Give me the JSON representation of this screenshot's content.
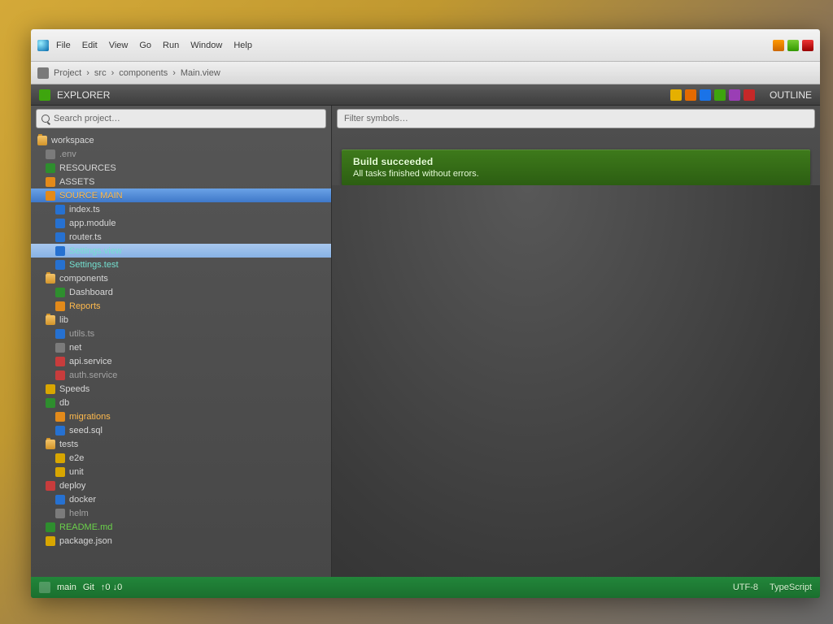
{
  "menubar": {
    "items": [
      "File",
      "Edit",
      "View",
      "Go",
      "Run",
      "Window",
      "Help"
    ]
  },
  "pathbar": {
    "root": "Project",
    "crumb1": "src",
    "crumb2": "components",
    "crumb3": "Main.view"
  },
  "secheader": {
    "label": "EXPLORER",
    "rightLabel": "OUTLINE"
  },
  "project_search_placeholder": "Search project…",
  "content_search_placeholder": "Filter symbols…",
  "tree": {
    "nodes": [
      {
        "label": "workspace",
        "icon": "folder",
        "cls": "",
        "lvl": 0
      },
      {
        "label": ".env",
        "icon": "gray",
        "cls": "dim",
        "lvl": 1
      },
      {
        "label": "RESOURCES",
        "icon": "green",
        "cls": "",
        "lvl": 1
      },
      {
        "label": "ASSETS",
        "icon": "orange",
        "cls": "",
        "lvl": 1
      },
      {
        "label": "SOURCE MAIN",
        "icon": "orange",
        "cls": "warn sel",
        "lvl": 1
      },
      {
        "label": "index.ts",
        "icon": "blue",
        "cls": "",
        "lvl": 2
      },
      {
        "label": "app.module",
        "icon": "blue",
        "cls": "",
        "lvl": 2
      },
      {
        "label": "router.ts",
        "icon": "blue",
        "cls": "",
        "lvl": 2
      },
      {
        "label": "Settings.view",
        "icon": "blue",
        "cls": "cyan sel2",
        "lvl": 2
      },
      {
        "label": "Settings.test",
        "icon": "blue",
        "cls": "cyan",
        "lvl": 2
      },
      {
        "label": "components",
        "icon": "folder",
        "cls": "",
        "lvl": 1
      },
      {
        "label": "Dashboard",
        "icon": "green",
        "cls": "",
        "lvl": 2
      },
      {
        "label": "Reports",
        "icon": "orange",
        "cls": "warn",
        "lvl": 2
      },
      {
        "label": "lib",
        "icon": "folder",
        "cls": "",
        "lvl": 1
      },
      {
        "label": "utils.ts",
        "icon": "blue",
        "cls": "dim",
        "lvl": 2
      },
      {
        "label": "net",
        "icon": "gray",
        "cls": "",
        "lvl": 2
      },
      {
        "label": "api.service",
        "icon": "red",
        "cls": "",
        "lvl": 2
      },
      {
        "label": "auth.service",
        "icon": "red",
        "cls": "dim",
        "lvl": 2
      },
      {
        "label": "Speeds",
        "icon": "yellow",
        "cls": "",
        "lvl": 1
      },
      {
        "label": "db",
        "icon": "green",
        "cls": "",
        "lvl": 1
      },
      {
        "label": "migrations",
        "icon": "orange",
        "cls": "warn",
        "lvl": 2
      },
      {
        "label": "seed.sql",
        "icon": "blue",
        "cls": "",
        "lvl": 2
      },
      {
        "label": "tests",
        "icon": "folder",
        "cls": "",
        "lvl": 1
      },
      {
        "label": "e2e",
        "icon": "yellow",
        "cls": "",
        "lvl": 2
      },
      {
        "label": "unit",
        "icon": "yellow",
        "cls": "",
        "lvl": 2
      },
      {
        "label": "deploy",
        "icon": "red",
        "cls": "",
        "lvl": 1
      },
      {
        "label": "docker",
        "icon": "blue",
        "cls": "",
        "lvl": 2
      },
      {
        "label": "helm",
        "icon": "gray",
        "cls": "dim",
        "lvl": 2
      },
      {
        "label": "README.md",
        "icon": "green",
        "cls": "green",
        "lvl": 1
      },
      {
        "label": "package.json",
        "icon": "yellow",
        "cls": "",
        "lvl": 1
      }
    ]
  },
  "banner": {
    "title": "Build succeeded",
    "subtitle": "All tasks finished without errors."
  },
  "statusbar": {
    "branch": "main",
    "git": "Git",
    "sync": "↑0 ↓0",
    "mode": "UTF-8",
    "lang": "TypeScript"
  }
}
